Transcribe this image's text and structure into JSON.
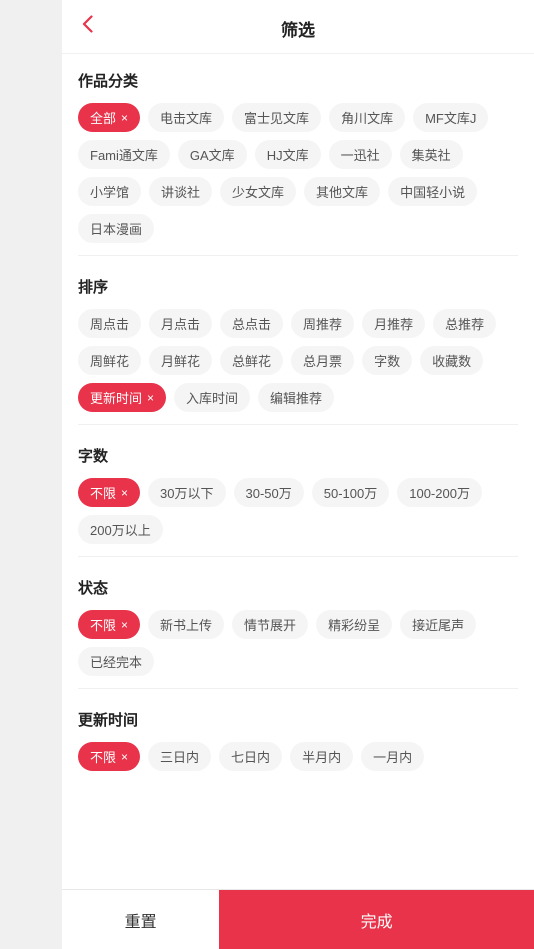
{
  "header": {
    "title": "筛选",
    "back_label": "‹"
  },
  "sections": {
    "category": {
      "title": "作品分类",
      "tags": [
        {
          "label": "全部",
          "active": true,
          "has_close": true
        },
        {
          "label": "电击文库",
          "active": false,
          "has_close": false
        },
        {
          "label": "富士见文库",
          "active": false,
          "has_close": false
        },
        {
          "label": "角川文库",
          "active": false,
          "has_close": false
        },
        {
          "label": "MF文库J",
          "active": false,
          "has_close": false
        },
        {
          "label": "Fami通文库",
          "active": false,
          "has_close": false
        },
        {
          "label": "GA文库",
          "active": false,
          "has_close": false
        },
        {
          "label": "HJ文库",
          "active": false,
          "has_close": false
        },
        {
          "label": "一迅社",
          "active": false,
          "has_close": false
        },
        {
          "label": "集英社",
          "active": false,
          "has_close": false
        },
        {
          "label": "小学馆",
          "active": false,
          "has_close": false
        },
        {
          "label": "讲谈社",
          "active": false,
          "has_close": false
        },
        {
          "label": "少女文库",
          "active": false,
          "has_close": false
        },
        {
          "label": "其他文库",
          "active": false,
          "has_close": false
        },
        {
          "label": "中国轻小说",
          "active": false,
          "has_close": false
        },
        {
          "label": "日本漫画",
          "active": false,
          "has_close": false
        }
      ]
    },
    "sort": {
      "title": "排序",
      "tags": [
        {
          "label": "周点击",
          "active": false,
          "has_close": false
        },
        {
          "label": "月点击",
          "active": false,
          "has_close": false
        },
        {
          "label": "总点击",
          "active": false,
          "has_close": false
        },
        {
          "label": "周推荐",
          "active": false,
          "has_close": false
        },
        {
          "label": "月推荐",
          "active": false,
          "has_close": false
        },
        {
          "label": "总推荐",
          "active": false,
          "has_close": false
        },
        {
          "label": "周鲜花",
          "active": false,
          "has_close": false
        },
        {
          "label": "月鲜花",
          "active": false,
          "has_close": false
        },
        {
          "label": "总鲜花",
          "active": false,
          "has_close": false
        },
        {
          "label": "总月票",
          "active": false,
          "has_close": false
        },
        {
          "label": "字数",
          "active": false,
          "has_close": false
        },
        {
          "label": "收藏数",
          "active": false,
          "has_close": false
        },
        {
          "label": "更新时间",
          "active": true,
          "has_close": true
        },
        {
          "label": "入库时间",
          "active": false,
          "has_close": false
        },
        {
          "label": "编辑推荐",
          "active": false,
          "has_close": false
        }
      ]
    },
    "wordcount": {
      "title": "字数",
      "tags": [
        {
          "label": "不限",
          "active": true,
          "has_close": true
        },
        {
          "label": "30万以下",
          "active": false,
          "has_close": false
        },
        {
          "label": "30-50万",
          "active": false,
          "has_close": false
        },
        {
          "label": "50-100万",
          "active": false,
          "has_close": false
        },
        {
          "label": "100-200万",
          "active": false,
          "has_close": false
        },
        {
          "label": "200万以上",
          "active": false,
          "has_close": false
        }
      ]
    },
    "status": {
      "title": "状态",
      "tags": [
        {
          "label": "不限",
          "active": true,
          "has_close": true
        },
        {
          "label": "新书上传",
          "active": false,
          "has_close": false
        },
        {
          "label": "情节展开",
          "active": false,
          "has_close": false
        },
        {
          "label": "精彩纷呈",
          "active": false,
          "has_close": false
        },
        {
          "label": "接近尾声",
          "active": false,
          "has_close": false
        },
        {
          "label": "已经完本",
          "active": false,
          "has_close": false
        }
      ]
    },
    "update_time": {
      "title": "更新时间",
      "tags": [
        {
          "label": "不限",
          "active": true,
          "has_close": true
        },
        {
          "label": "三日内",
          "active": false,
          "has_close": false
        },
        {
          "label": "七日内",
          "active": false,
          "has_close": false
        },
        {
          "label": "半月内",
          "active": false,
          "has_close": false
        },
        {
          "label": "一月内",
          "active": false,
          "has_close": false
        }
      ]
    }
  },
  "footer": {
    "reset_label": "重置",
    "confirm_label": "完成"
  }
}
